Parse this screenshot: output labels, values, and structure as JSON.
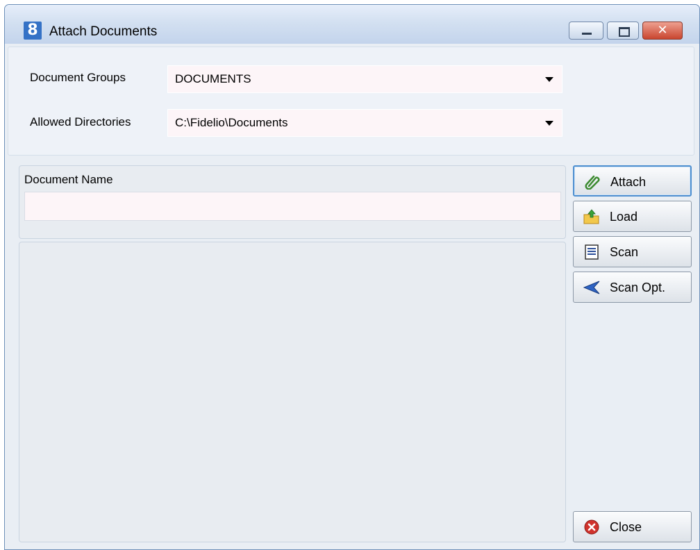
{
  "window": {
    "title": "Attach Documents",
    "icon_text": "8"
  },
  "form": {
    "document_groups": {
      "label": "Document Groups",
      "value": "DOCUMENTS"
    },
    "allowed_directories": {
      "label": "Allowed Directories",
      "value": "C:\\Fidelio\\Documents"
    },
    "document_name": {
      "label": "Document Name",
      "value": ""
    }
  },
  "buttons": {
    "attach": "Attach",
    "load": "Load",
    "scan": "Scan",
    "scan_opt": "Scan Opt.",
    "close": "Close"
  },
  "icons": {
    "attach": "paperclip-icon",
    "load": "folder-upload-icon",
    "scan": "document-icon",
    "scan_opt": "blue-arrow-icon",
    "close": "red-x-icon"
  },
  "colors": {
    "window_frame": "#a9c3e0",
    "input_bg": "#fdf5f8",
    "focus": "#4e8fd0"
  }
}
